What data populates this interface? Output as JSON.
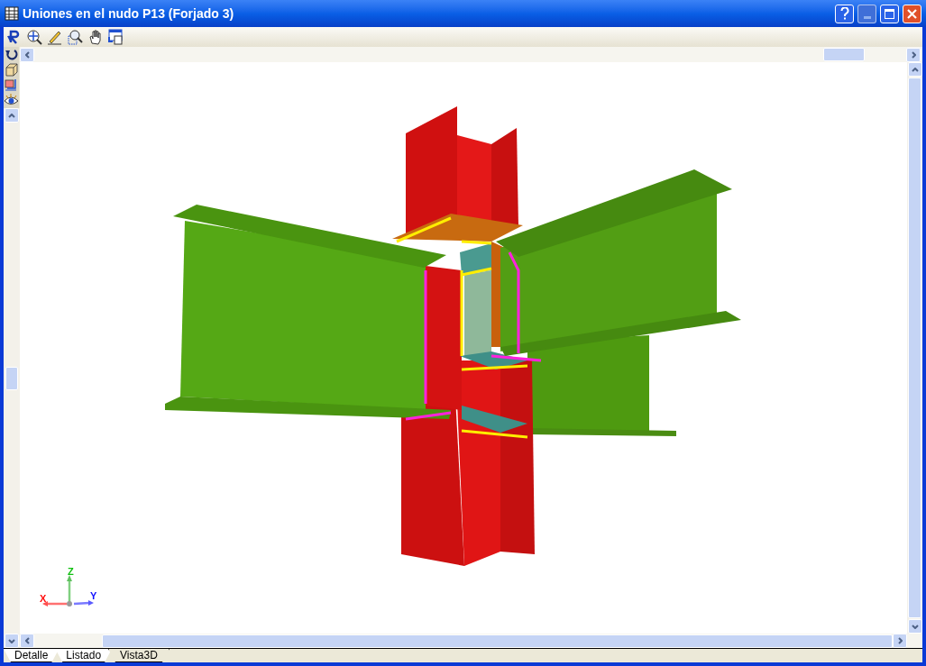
{
  "window": {
    "title": "Uniones en el nudo P13 (Forjado 3)"
  },
  "axes": {
    "x": "X",
    "y": "Y",
    "z": "Z"
  },
  "tabs": [
    {
      "label": "Detalle",
      "selected": false
    },
    {
      "label": "Listado",
      "selected": false
    },
    {
      "label": "Vista3D",
      "selected": true
    }
  ]
}
